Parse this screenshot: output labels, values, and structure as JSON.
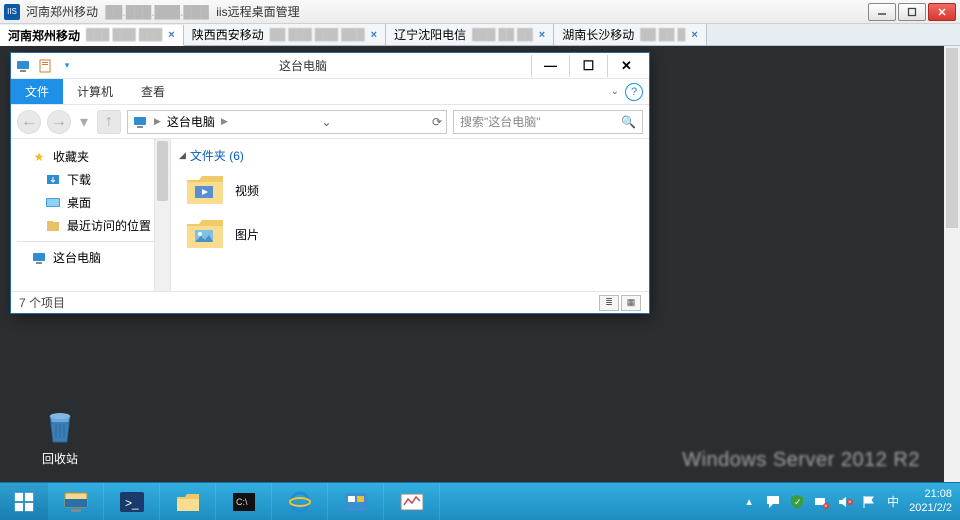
{
  "app": {
    "title_server": "河南郑州移动",
    "title_ip": "██.███.███.███",
    "title_suffix": "iis远程桌面管理"
  },
  "tabs": [
    {
      "label": "河南郑州移动",
      "ip": "███ ███ ███",
      "active": true
    },
    {
      "label": "陕西西安移动",
      "ip": "██ ███ ███ ███",
      "active": false
    },
    {
      "label": "辽宁沈阳电信",
      "ip": "███ ██ ██",
      "active": false
    },
    {
      "label": "湖南长沙移动",
      "ip": "██ ██ █",
      "active": false
    }
  ],
  "desktop": {
    "recycle_bin": "回收站",
    "watermark": "Windows Server 2012 R2"
  },
  "taskbar": {
    "time": "21:08",
    "date": "2021/2/2"
  },
  "explorer": {
    "title": "这台电脑",
    "ribbon": {
      "file": "文件",
      "computer": "计算机",
      "view": "查看"
    },
    "breadcrumb": {
      "root": "这台电脑"
    },
    "search_placeholder": "搜索\"这台电脑\"",
    "nav": {
      "favorites": "收藏夹",
      "downloads": "下载",
      "desktop": "桌面",
      "recent": "最近访问的位置",
      "this_pc": "这台电脑"
    },
    "group_header": "文件夹 (6)",
    "items": [
      {
        "label": "视频"
      },
      {
        "label": "图片"
      }
    ],
    "status": "7 个项目"
  }
}
